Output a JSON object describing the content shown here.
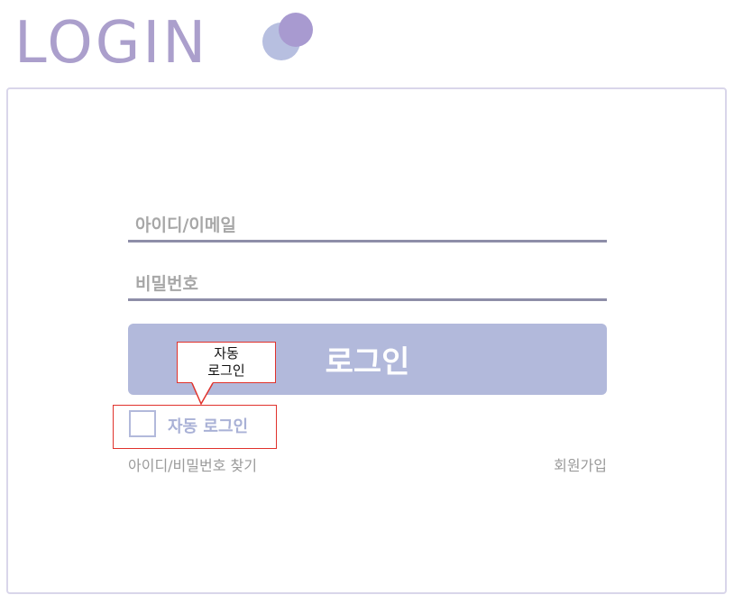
{
  "logo": {
    "text": "LOGIN",
    "mark_icon": "overlapping-circles-icon",
    "colors": {
      "text": "#ab9fcc",
      "circle_back": "#b7bfe0",
      "circle_front": "#a89ad0"
    }
  },
  "form": {
    "id_placeholder": "아이디/이메일",
    "id_value": "",
    "password_placeholder": "비밀번호",
    "password_value": "",
    "login_label": "로그인",
    "login_color": "#b2b9db"
  },
  "tooltip": {
    "line1": "자동",
    "line2": "로그인"
  },
  "auto_login": {
    "label": "자동 로그인",
    "checked": false
  },
  "links": {
    "find": "아이디/비밀번호 찾기",
    "join": "회원가입"
  }
}
